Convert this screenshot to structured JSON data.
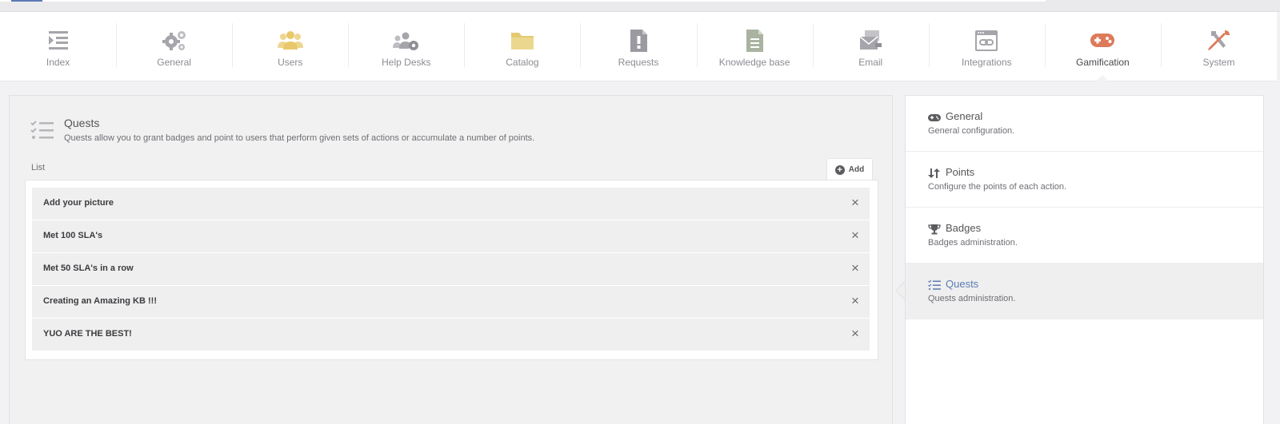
{
  "nav": {
    "items": [
      {
        "label": "Index",
        "icon": "index-icon",
        "color": "#a5a5ab"
      },
      {
        "label": "General",
        "icon": "gears-icon",
        "color": "#a5a5ab"
      },
      {
        "label": "Users",
        "icon": "users-icon",
        "color": "#e8c86a"
      },
      {
        "label": "Help Desks",
        "icon": "help-desks-icon",
        "color": "#a5a5ab"
      },
      {
        "label": "Catalog",
        "icon": "folder-icon",
        "color": "#ecd78e"
      },
      {
        "label": "Requests",
        "icon": "request-file-icon",
        "color": "#a5a5ab"
      },
      {
        "label": "Knowledge base",
        "icon": "document-icon",
        "color": "#a9b3a0"
      },
      {
        "label": "Email",
        "icon": "email-icon",
        "color": "#a5a5ab"
      },
      {
        "label": "Integrations",
        "icon": "integrations-icon",
        "color": "#a5a5ab"
      },
      {
        "label": "Gamification",
        "icon": "gamepad-icon",
        "color": "#de7a5a"
      },
      {
        "label": "System",
        "icon": "tools-icon",
        "color": "#de7a5a"
      }
    ],
    "active": "Gamification"
  },
  "section": {
    "title": "Quests",
    "description": "Quests allow you to grant badges and point to users that perform given sets of actions or accumulate a number of points.",
    "icon": "checklist-icon"
  },
  "list": {
    "label": "List",
    "add_label": "Add",
    "rows": [
      {
        "label": "Add your picture"
      },
      {
        "label": "Met 100 SLA's"
      },
      {
        "label": "Met 50 SLA's in a row"
      },
      {
        "label": "Creating an Amazing KB !!!"
      },
      {
        "label": "YUO ARE THE BEST!"
      }
    ],
    "close_glyph": "×"
  },
  "sidebar": {
    "items": [
      {
        "title": "General",
        "description": "General configuration.",
        "icon": "gamepad-icon"
      },
      {
        "title": "Points",
        "description": "Configure the points of each action.",
        "icon": "sort-arrows-icon"
      },
      {
        "title": "Badges",
        "description": "Badges administration.",
        "icon": "trophy-icon"
      },
      {
        "title": "Quests",
        "description": "Quests administration.",
        "icon": "checklist-icon"
      }
    ],
    "active": "Quests",
    "accent": "#5b7bb3"
  }
}
